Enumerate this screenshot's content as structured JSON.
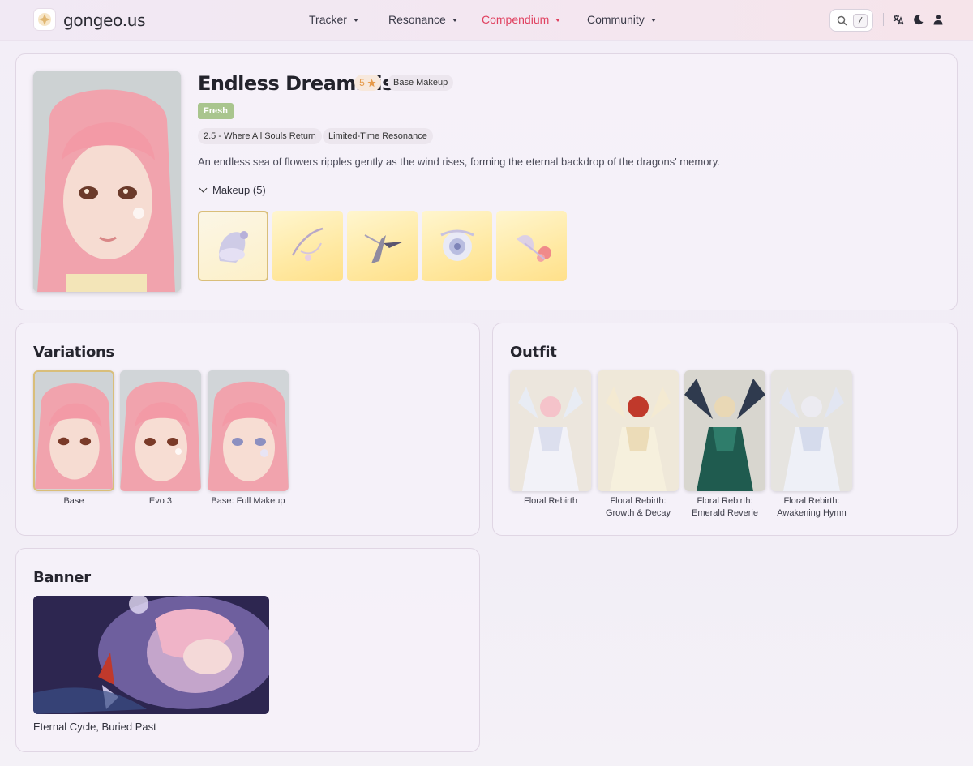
{
  "header": {
    "brand": "gongeo.us",
    "nav": [
      {
        "label": "Tracker"
      },
      {
        "label": "Resonance"
      },
      {
        "label": "Compendium",
        "active": true
      },
      {
        "label": "Community"
      }
    ],
    "search_shortcut": "/",
    "icons": [
      "search-icon",
      "translate-icon",
      "moon-icon",
      "user-icon"
    ]
  },
  "item": {
    "title": "Endless Dreammist",
    "rarity": "5",
    "category": "Base Makeup",
    "style_tag": "Fresh",
    "version": "2.5 - Where All Souls Return",
    "source": "Limited-Time Resonance",
    "description": "An endless sea of flowers ripples gently as the wind rises, forming the eternal backdrop of the dragons' memory.",
    "makeup_toggle": "Makeup (5)"
  },
  "variations": {
    "title": "Variations",
    "items": [
      {
        "label": "Base"
      },
      {
        "label": "Evo 3"
      },
      {
        "label": "Base: Full Makeup"
      }
    ]
  },
  "outfit": {
    "title": "Outfit",
    "items": [
      {
        "line1": "Floral Rebirth",
        "line2": ""
      },
      {
        "line1": "Floral Rebirth:",
        "line2": "Growth & Decay"
      },
      {
        "line1": "Floral Rebirth:",
        "line2": "Emerald Reverie"
      },
      {
        "line1": "Floral Rebirth:",
        "line2": "Awakening Hymn"
      }
    ]
  },
  "banner": {
    "title": "Banner",
    "caption": "Eternal Cycle, Buried Past"
  },
  "colors": {
    "accent_nav": "#e0405f",
    "rarity_star": "#e69a4a",
    "fresh_tag": "#a9c58e",
    "selected_border": "#d9be7a"
  }
}
